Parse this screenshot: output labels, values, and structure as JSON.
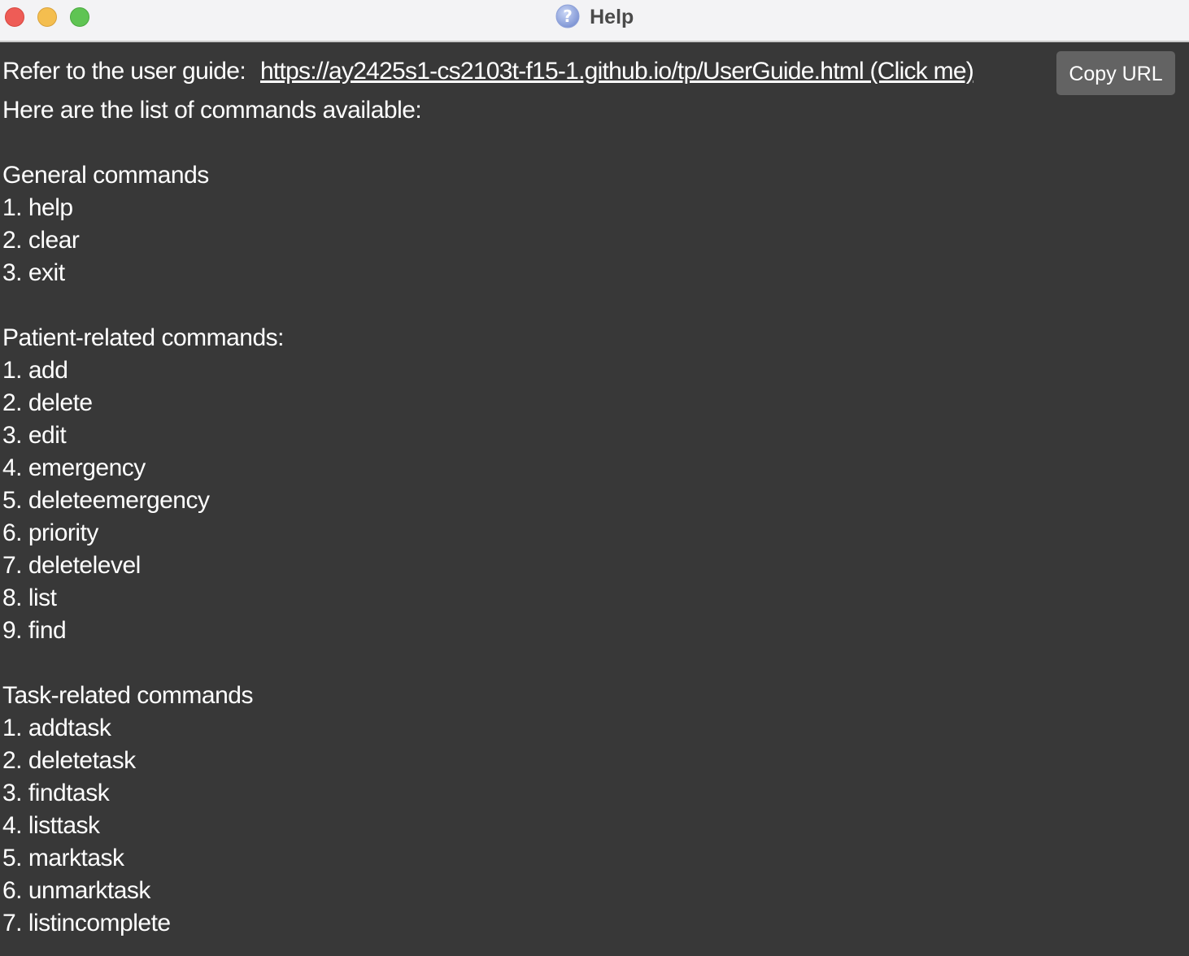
{
  "window": {
    "title": "Help",
    "title_icon": "help-question-icon",
    "controls": [
      "close",
      "minimize",
      "maximize"
    ]
  },
  "guide": {
    "prefix": "Refer to the user guide:",
    "url_text": "https://ay2425s1-cs2103t-f15-1.github.io/tp/UserGuide.html (Click me)",
    "copy_button": "Copy URL"
  },
  "intro": "Here are the list of commands available:",
  "general": {
    "heading": "General commands",
    "items": [
      "1. help",
      "2. clear",
      "3. exit"
    ]
  },
  "patient": {
    "heading": "Patient-related commands:",
    "items": [
      "1. add",
      "2. delete",
      "3. edit",
      "4. emergency",
      "5. deleteemergency",
      "6. priority",
      "7. deletelevel",
      "8. list",
      "9. find"
    ]
  },
  "task": {
    "heading": "Task-related commands",
    "items": [
      "1. addtask",
      "2. deletetask",
      "3. findtask",
      "4. listtask",
      "5. marktask",
      "6. unmarktask",
      "7. listincomplete"
    ]
  },
  "colors": {
    "background": "#383838",
    "titlebar": "#f3f3f5",
    "text": "#ffffff",
    "button": "#636363",
    "close": "#ee5c56",
    "minimize": "#f4be4f",
    "maximize": "#5fc453"
  }
}
